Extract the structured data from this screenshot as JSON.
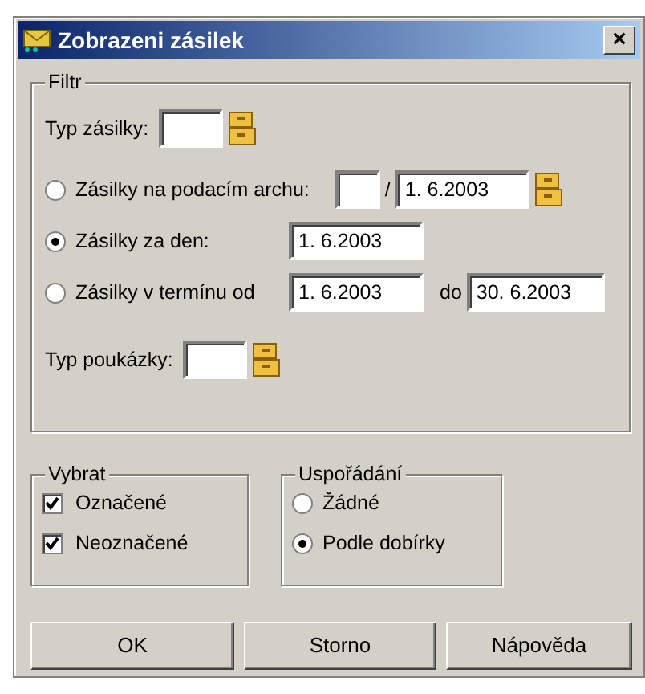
{
  "window": {
    "title": "Zobrazeni zásilek",
    "close": "×"
  },
  "filter": {
    "legend": "Filtr",
    "shipment_type_label": "Typ zásilky:",
    "options": [
      {
        "kind": "archive",
        "label": "Zásilky na podacím archu:",
        "selected": false,
        "separator": "/",
        "date": "1. 6.2003"
      },
      {
        "kind": "day",
        "label": "Zásilky za den:",
        "selected": true,
        "date": "1. 6.2003"
      },
      {
        "kind": "range",
        "label": "Zásilky v termínu od",
        "selected": false,
        "from": "1. 6.2003",
        "to_label": "do",
        "to": "30. 6.2003"
      }
    ],
    "voucher_type_label": "Typ poukázky:"
  },
  "select": {
    "legend": "Vybrat",
    "items": [
      {
        "label": "Označené",
        "checked": true
      },
      {
        "label": "Neoznačené",
        "checked": true
      }
    ]
  },
  "ordering": {
    "legend": "Uspořádání",
    "items": [
      {
        "label": "Žádné",
        "selected": false
      },
      {
        "label": "Podle dobírky",
        "selected": true
      }
    ]
  },
  "buttons": [
    "OK",
    "Storno",
    "Nápověda"
  ]
}
